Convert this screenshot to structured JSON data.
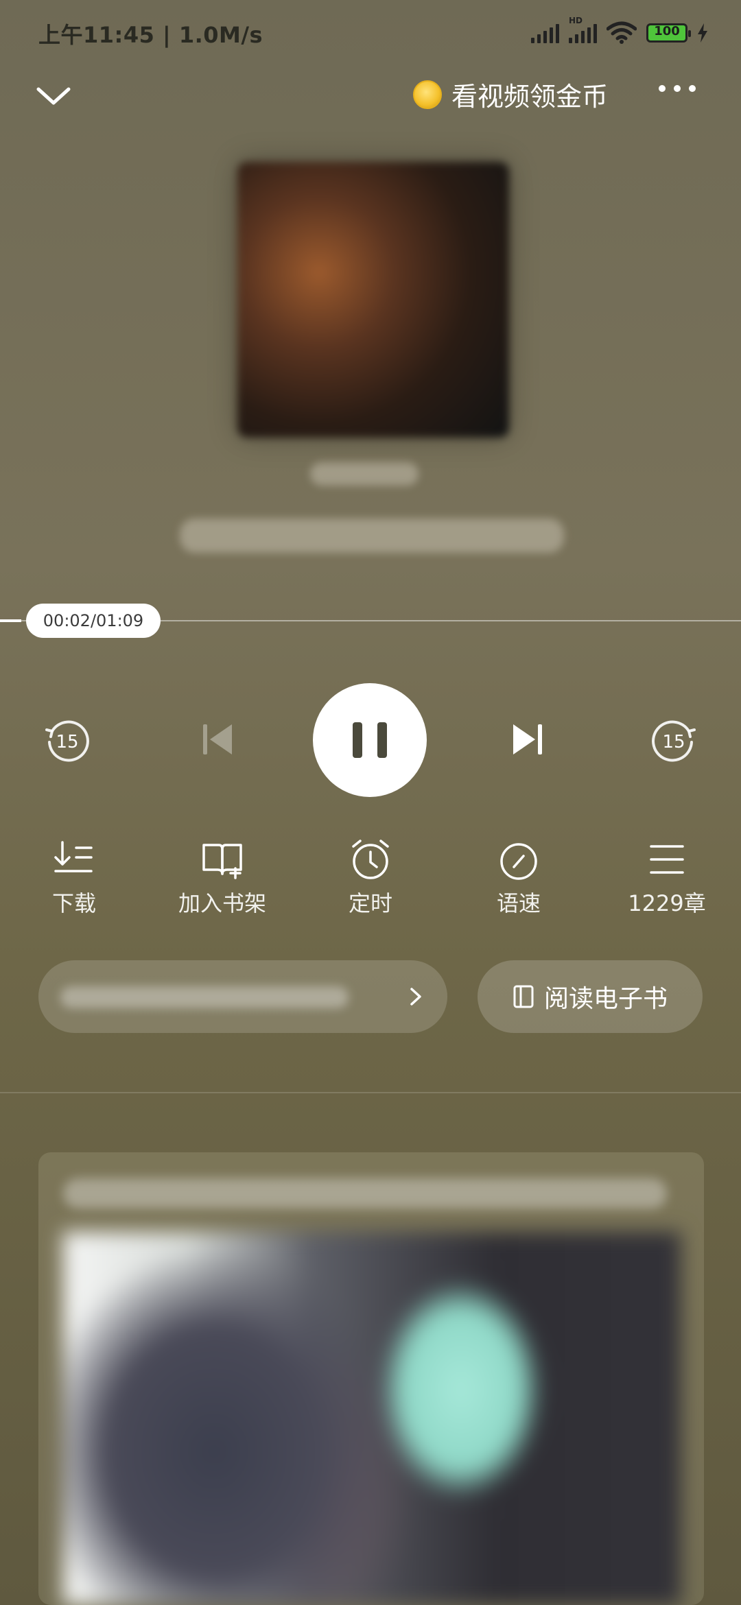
{
  "status_bar": {
    "time": "上午11:45 | 1.0M/s",
    "battery": "100",
    "signal_hd": "HD"
  },
  "header": {
    "reward_label": "看视频领金币",
    "back_icon": "chevron-down-icon",
    "more_icon": "more-dots-icon"
  },
  "player": {
    "time_display": "00:02/01:09",
    "progress": 0.029,
    "rewind_seconds": "15",
    "forward_seconds": "15"
  },
  "actions": [
    {
      "label": "下载",
      "icon": "download-list-icon"
    },
    {
      "label": "加入书架",
      "icon": "bookshelf-add-icon"
    },
    {
      "label": "定时",
      "icon": "alarm-clock-icon"
    },
    {
      "label": "语速",
      "icon": "speed-gauge-icon"
    },
    {
      "label": "1229章",
      "icon": "chapter-list-icon"
    }
  ],
  "read_ebook": {
    "label": "阅读电子书",
    "icon": "book-icon"
  },
  "colors": {
    "background": "#6f6a55",
    "accent": "#ffffff",
    "coin": "#f4c02a"
  }
}
